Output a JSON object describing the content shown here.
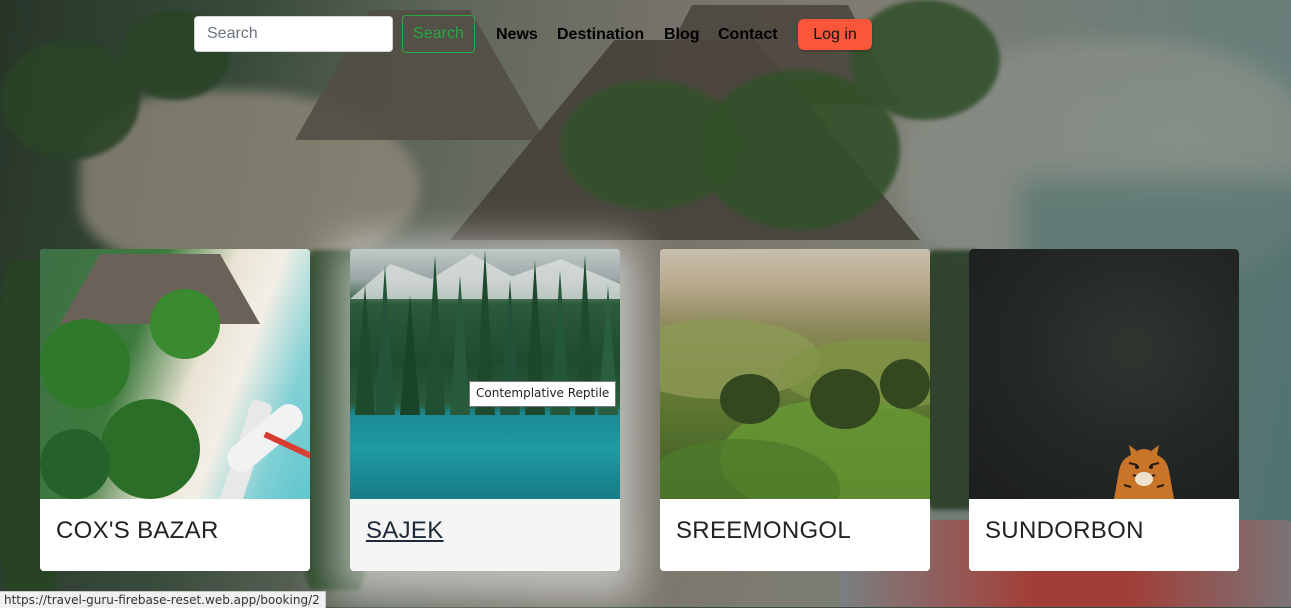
{
  "navbar": {
    "logo_text": "",
    "search_placeholder": "Search",
    "search_button_label": "Search",
    "links": [
      "News",
      "Destination",
      "Blog",
      "Contact"
    ],
    "login_label": "Log in",
    "login_color": "#f9563a",
    "search_button_color": "#28a745"
  },
  "cards": [
    {
      "title": "COX'S BAZAR",
      "image": "beach-resort-image"
    },
    {
      "title": "SAJEK",
      "image": "forest-lake-image",
      "hovered": true
    },
    {
      "title": "SREEMONGOL",
      "image": "tea-hills-image"
    },
    {
      "title": "SUNDORBON",
      "image": "tiger-forest-image"
    }
  ],
  "tooltip": "Contemplative Reptile",
  "status_url": "https://travel-guru-firebase-reset.web.app/booking/2"
}
